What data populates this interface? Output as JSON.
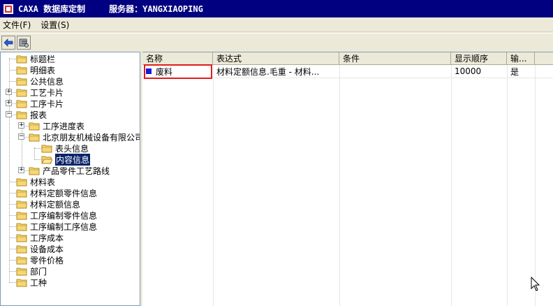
{
  "window": {
    "app_title": "CAXA 数据库定制",
    "server_label": "服务器：YANGXIAOPING"
  },
  "menu": {
    "file": "文件(F)",
    "settings": "设置(S)"
  },
  "tree": {
    "items": [
      {
        "label": "标题栏"
      },
      {
        "label": "明细表"
      },
      {
        "label": "公共信息"
      },
      {
        "label": "工艺卡片"
      },
      {
        "label": "工序卡片"
      },
      {
        "label": "报表"
      },
      {
        "label": "工序进度表"
      },
      {
        "label": "北京朋友机械设备有限公司"
      },
      {
        "label": "表头信息"
      },
      {
        "label": "内容信息"
      },
      {
        "label": "产品零件工艺路线"
      },
      {
        "label": "材料表"
      },
      {
        "label": "材料定额零件信息"
      },
      {
        "label": "材料定额信息"
      },
      {
        "label": "工序编制零件信息"
      },
      {
        "label": "工序编制工序信息"
      },
      {
        "label": "工序成本"
      },
      {
        "label": "设备成本"
      },
      {
        "label": "零件价格"
      },
      {
        "label": "部门"
      },
      {
        "label": "工种"
      }
    ]
  },
  "grid": {
    "columns": [
      "名称",
      "表达式",
      "条件",
      "显示顺序",
      "输..."
    ],
    "rows": [
      {
        "name": "废料",
        "expression": "材料定额信息.毛重 - 材料...",
        "condition": "",
        "order": "10000",
        "output": "是"
      }
    ]
  },
  "colors": {
    "titlebar": "#000080",
    "selection": "#0a246a",
    "highlight_box": "#e21b1b",
    "bullet": "#1a1adc"
  }
}
